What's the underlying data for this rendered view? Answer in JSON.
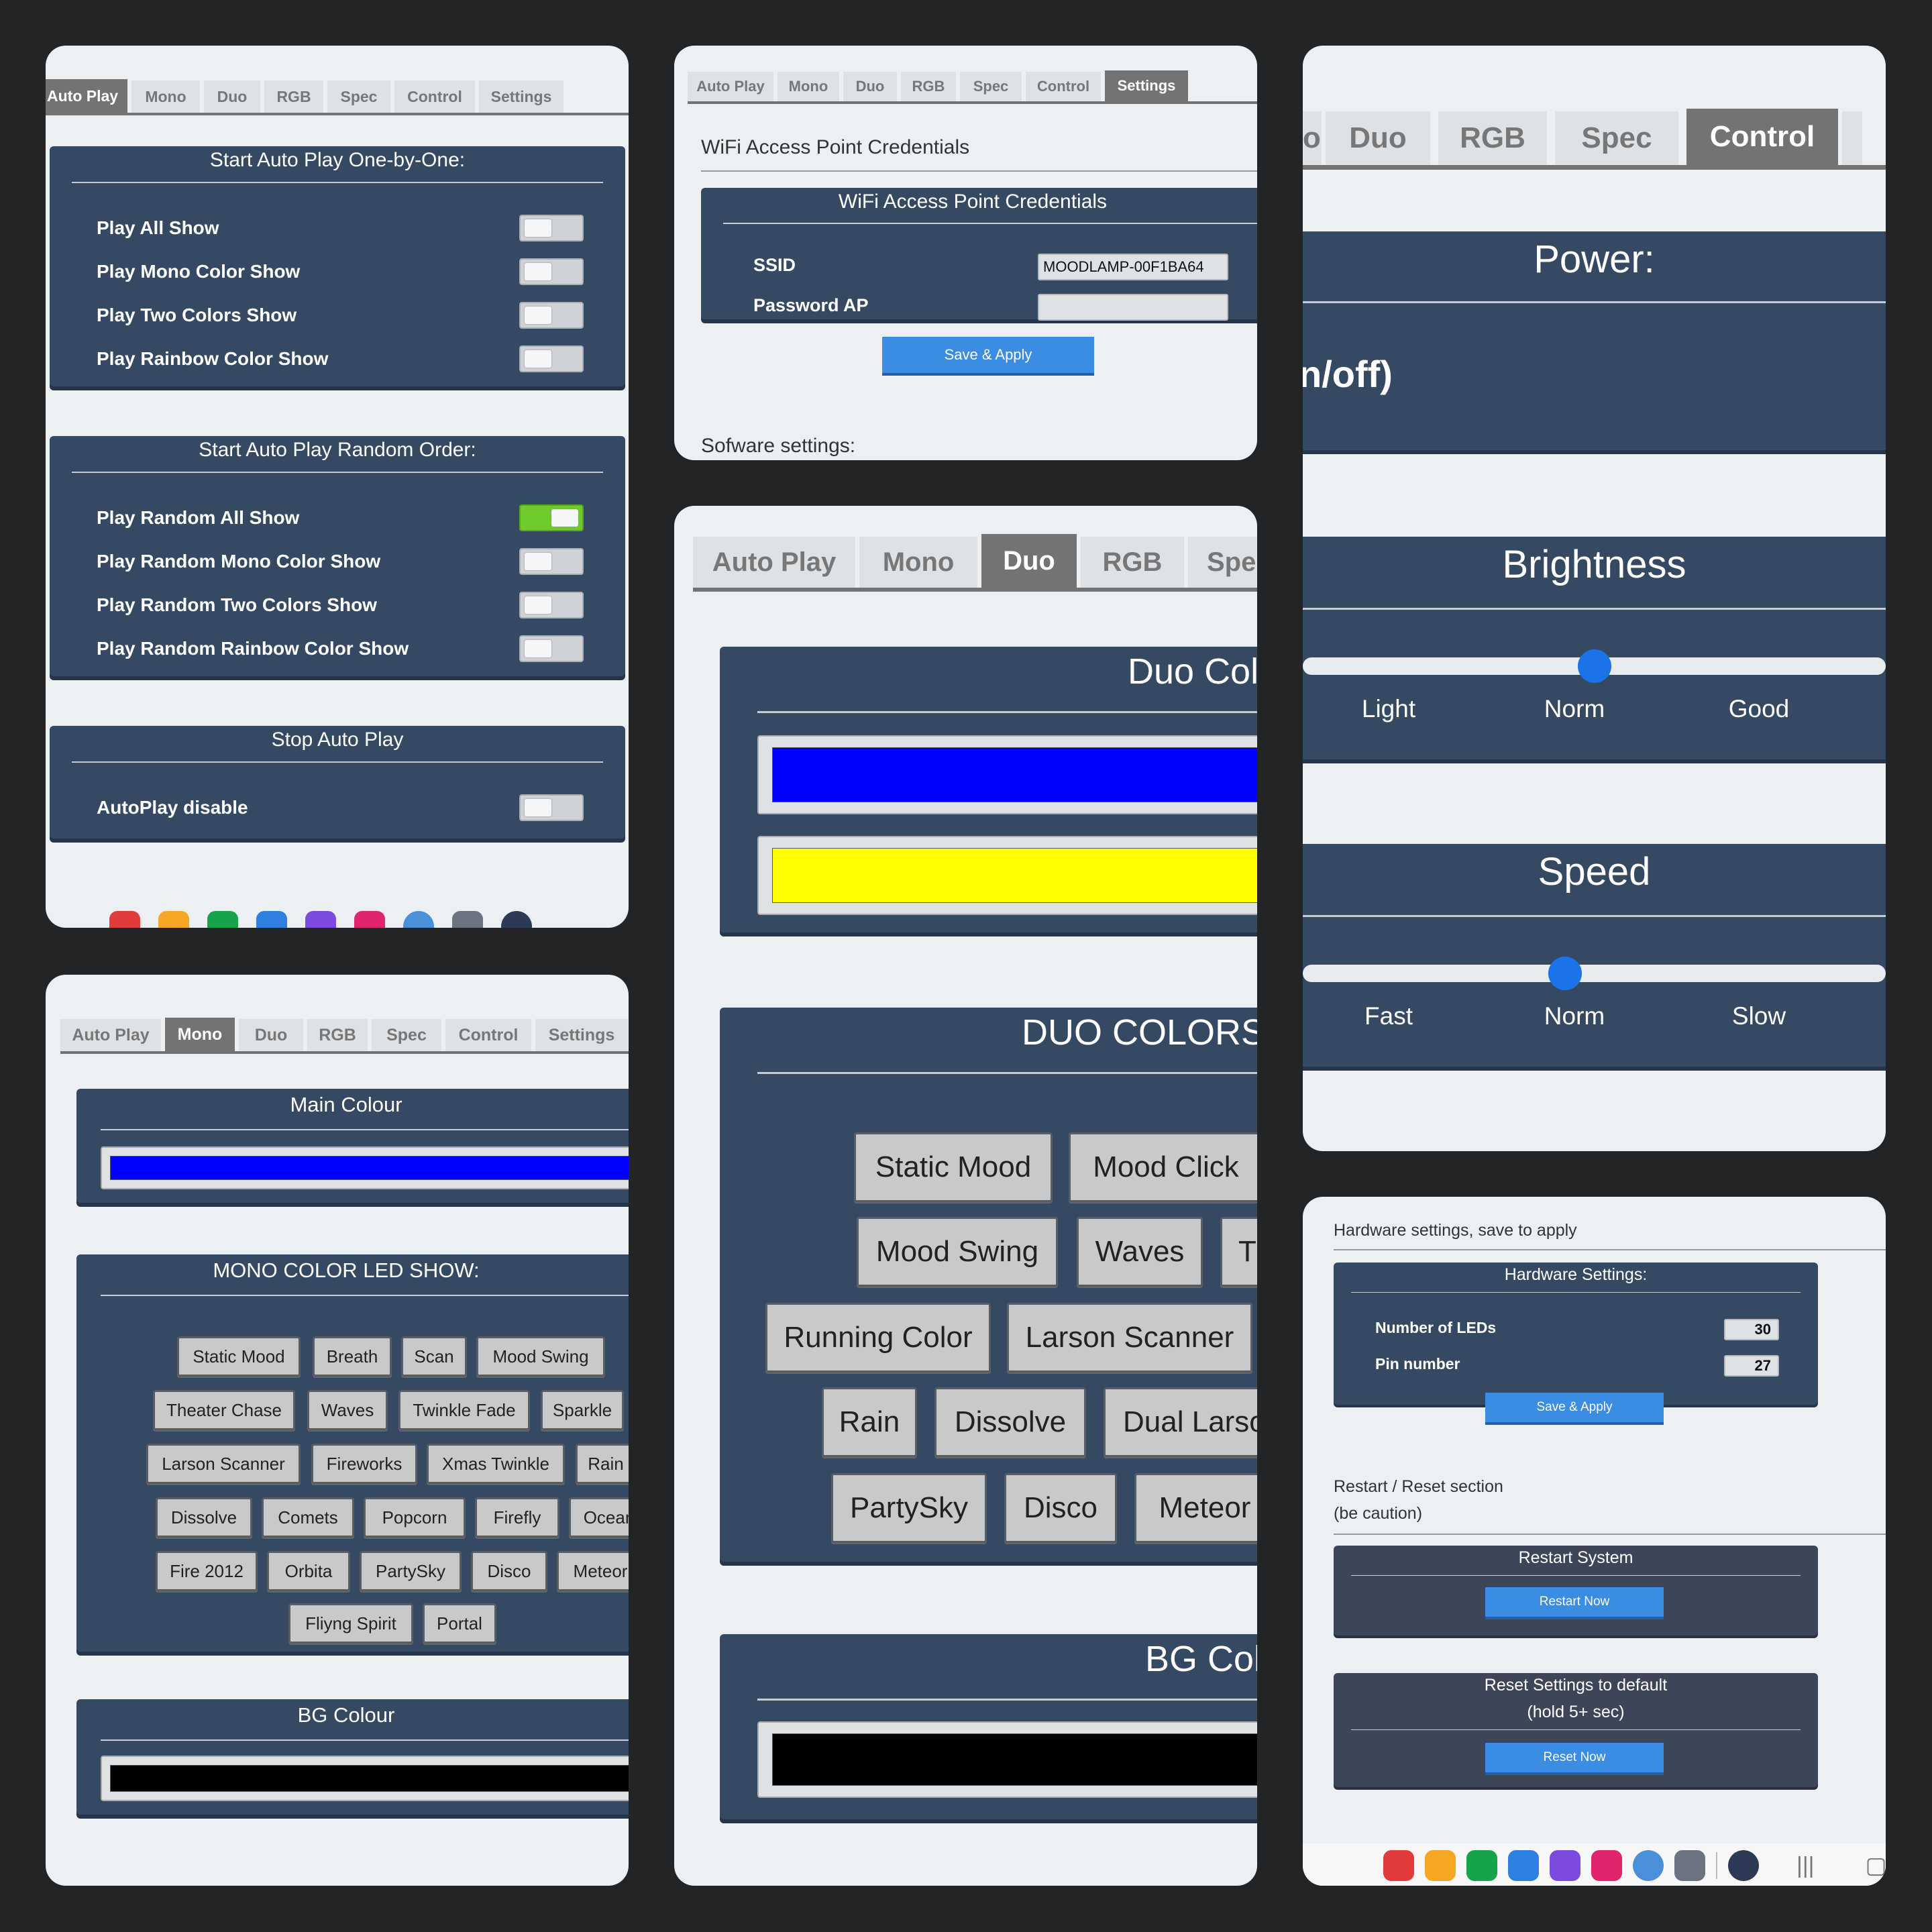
{
  "tabs": {
    "auto_play": "Auto Play",
    "mono": "Mono",
    "duo": "Duo",
    "rgb": "RGB",
    "spec": "Spec",
    "control": "Control",
    "settings": "Settings",
    "spec_cut": "Spe",
    "mono_cut": "o"
  },
  "autoplay": {
    "section1": {
      "title": "Start Auto Play One-by-One:",
      "items": [
        {
          "label": "Play All Show",
          "on": false
        },
        {
          "label": "Play Mono Color Show",
          "on": false
        },
        {
          "label": "Play Two Colors Show",
          "on": false
        },
        {
          "label": "Play Rainbow Color Show",
          "on": false
        }
      ]
    },
    "section2": {
      "title": "Start Auto Play Random Order:",
      "items": [
        {
          "label": "Play Random All Show",
          "on": true
        },
        {
          "label": "Play Random Mono Color Show",
          "on": false
        },
        {
          "label": "Play Random Two Colors Show",
          "on": false
        },
        {
          "label": "Play Random Rainbow Color Show",
          "on": false
        }
      ]
    },
    "section3": {
      "title": "Stop Auto Play",
      "items": [
        {
          "label": "AutoPlay disable",
          "on": false
        }
      ]
    }
  },
  "settings": {
    "heading": "WiFi Access Point Credentials",
    "panel_title": "WiFi Access Point Credentials",
    "ssid_label": "SSID",
    "ssid_value": "MOODLAMP-00F1BA64",
    "password_label": "Password AP",
    "password_value": "",
    "save_label": "Save & Apply",
    "software_heading": "Sofware settings:"
  },
  "control": {
    "power_title": "Power:",
    "power_text": "n/off)",
    "brightness_title": "Brightness",
    "brightness_labels": [
      "Light",
      "Norm",
      "Good"
    ],
    "brightness_level": 0.5,
    "speed_title": "Speed",
    "speed_labels": [
      "Fast",
      "Norm",
      "Slow"
    ],
    "speed_level": 0.45
  },
  "mono": {
    "main_title": "Main Colour",
    "main_color": "#0000ff",
    "show_title": "MONO COLOR LED SHOW:",
    "shows": [
      [
        "Static Mood",
        "Breath",
        "Scan",
        "Mood Swing"
      ],
      [
        "Theater Chase",
        "Waves",
        "Twinkle Fade",
        "Sparkle"
      ],
      [
        "Larson Scanner",
        "Fireworks",
        "Xmas Twinkle",
        "Rain"
      ],
      [
        "Dissolve",
        "Comets",
        "Popcorn",
        "Firefly",
        "Ocean"
      ],
      [
        "Fire 2012",
        "Orbita",
        "PartySky",
        "Disco",
        "Meteor"
      ],
      [
        "Fliyng Spirit",
        "Portal"
      ]
    ],
    "bg_title": "BG Colour",
    "bg_color": "#000000"
  },
  "duo": {
    "colors_title": "Duo Colo",
    "color1": "#0000ff",
    "color2": "#ffff00",
    "list_title": "DUO COLORS L",
    "shows": [
      [
        "Static Mood",
        "Mood Click"
      ],
      [
        "Mood Swing",
        "Waves",
        "T"
      ],
      [
        "Running Color",
        "Larson Scanner"
      ],
      [
        "Rain",
        "Dissolve",
        "Dual Larso"
      ],
      [
        "PartySky",
        "Disco",
        "Meteor"
      ]
    ],
    "bg_title": "BG Colo",
    "bg_color": "#000000"
  },
  "hardware": {
    "heading": "Hardware settings, save to apply",
    "panel_title": "Hardware Settings:",
    "leds_label": "Number of LEDs",
    "leds_value": "30",
    "pin_label": "Pin number",
    "pin_value": "27",
    "save_label": "Save & Apply",
    "restart_heading_1": "Restart / Reset section",
    "restart_heading_2": "(be caution)",
    "restart_title": "Restart System",
    "restart_btn": "Restart Now",
    "reset_title_1": "Reset Settings to default",
    "reset_title_2": "(hold 5+ sec)",
    "reset_btn": "Reset Now"
  },
  "dock_icons": [
    "red-app-icon",
    "files-icon",
    "phone-icon",
    "messages-icon",
    "browser-icon",
    "camera-icon",
    "chrome-icon",
    "apps-grid-icon",
    "settings-icon"
  ],
  "colors": {
    "panel": "#354a62",
    "accent_blue": "#3b8de3",
    "toggle_on": "#6fcb2c",
    "active_tab": "#737373"
  }
}
